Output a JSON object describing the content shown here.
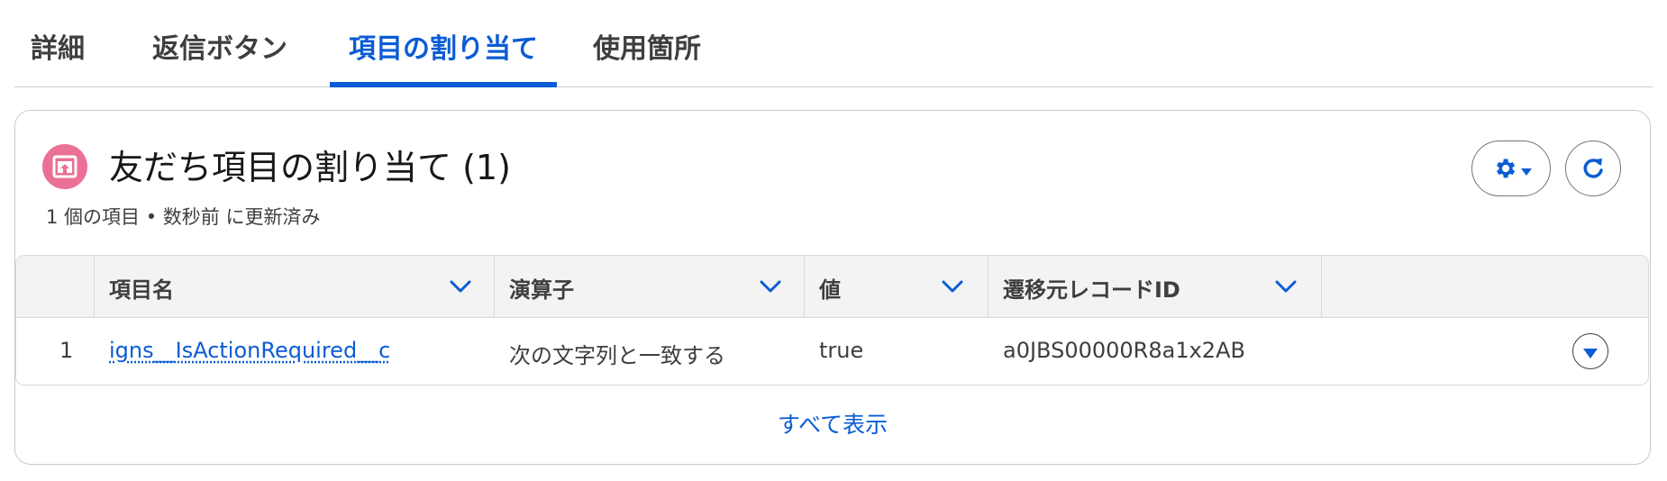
{
  "tabs": [
    {
      "label": "詳細",
      "active": false
    },
    {
      "label": "返信ボタン",
      "active": false
    },
    {
      "label": "項目の割り当て",
      "active": true
    },
    {
      "label": "使用箇所",
      "active": false
    }
  ],
  "card": {
    "title": "友だち項目の割り当て (1)",
    "subtitle": "1 個の項目 • 数秒前 に更新済み",
    "icon": "custom-object-icon",
    "settings_button_icon": "gear-icon",
    "refresh_button_icon": "refresh-icon"
  },
  "table": {
    "columns": [
      "項目名",
      "演算子",
      "値",
      "遷移元レコードID"
    ],
    "rows": [
      {
        "row_number": "1",
        "field_name": "igns__IsActionRequired__c",
        "operator": "次の文字列と一致する",
        "value": "true",
        "source_record_id": "a0JBS00000R8a1x2AB"
      }
    ]
  },
  "footer": {
    "view_all_label": "すべて表示"
  },
  "colors": {
    "accent": "#0b5cd5",
    "icon_bg": "#ea7195",
    "header_bg": "#f3f3f3"
  }
}
